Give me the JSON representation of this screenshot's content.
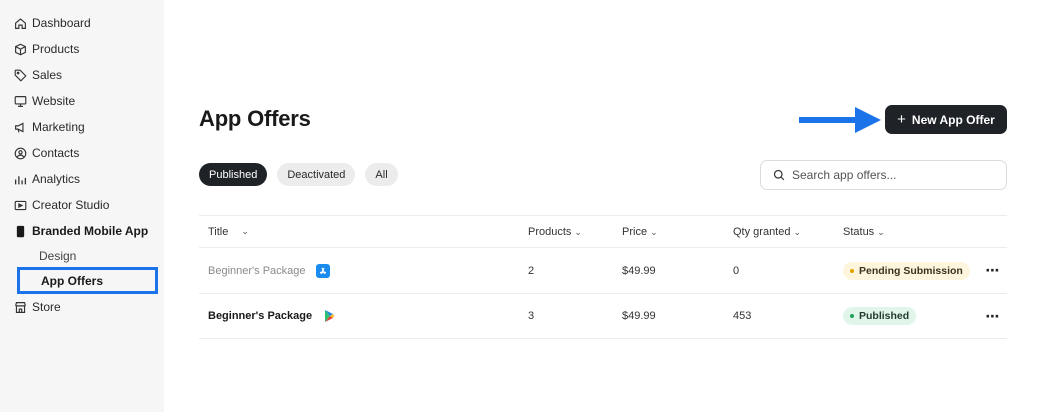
{
  "sidebar": {
    "items": [
      {
        "label": "Dashboard",
        "icon": "home-icon"
      },
      {
        "label": "Products",
        "icon": "box-icon"
      },
      {
        "label": "Sales",
        "icon": "tag-icon"
      },
      {
        "label": "Website",
        "icon": "monitor-icon"
      },
      {
        "label": "Marketing",
        "icon": "megaphone-icon"
      },
      {
        "label": "Contacts",
        "icon": "contact-icon"
      },
      {
        "label": "Analytics",
        "icon": "bar-chart-icon"
      },
      {
        "label": "Creator Studio",
        "icon": "studio-icon"
      },
      {
        "label": "Branded Mobile App",
        "icon": "phone-icon"
      }
    ],
    "sub_items": [
      {
        "label": "Design"
      },
      {
        "label": "App Offers"
      }
    ],
    "store": {
      "label": "Store",
      "icon": "store-icon"
    }
  },
  "page": {
    "title": "App Offers",
    "new_button_label": "New App Offer"
  },
  "filters": [
    "Published",
    "Deactivated",
    "All"
  ],
  "search": {
    "placeholder": "Search app offers..."
  },
  "table": {
    "headers": [
      "Title",
      "Products",
      "Price",
      "Qty granted",
      "Status"
    ],
    "rows": [
      {
        "title": "Beginner's Package",
        "store": "app-store-icon",
        "products": "2",
        "price": "$49.99",
        "qty": "0",
        "status": "Pending Submission"
      },
      {
        "title": "Beginner's Package",
        "store": "google-play-icon",
        "products": "3",
        "price": "$49.99",
        "qty": "453",
        "status": "Published"
      }
    ]
  },
  "colors": {
    "accent": "#1a73e8",
    "dark": "#1f2328",
    "pending": "#e0a400",
    "published": "#1fa35c"
  }
}
